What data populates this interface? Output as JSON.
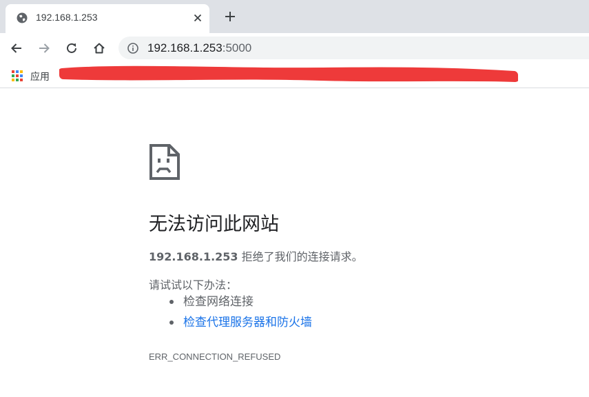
{
  "tab": {
    "title": "192.168.1.253",
    "favicon": "globe-icon"
  },
  "toolbar": {
    "url_host": "192.168.1.253",
    "url_port": ":5000"
  },
  "bookmarks": {
    "apps_label": "应用"
  },
  "error": {
    "title": "无法访问此网站",
    "host": "192.168.1.253",
    "message": " 拒绝了我们的连接请求。",
    "try_label": "请试试以下办法：",
    "suggestions": [
      "检查网络连接",
      "检查代理服务器和防火墙"
    ],
    "code": "ERR_CONNECTION_REFUSED"
  },
  "colors": {
    "link": "#1a73e8",
    "text_secondary": "#5f6368",
    "redaction": "#ee3a3a",
    "tabstrip": "#dee1e6"
  }
}
